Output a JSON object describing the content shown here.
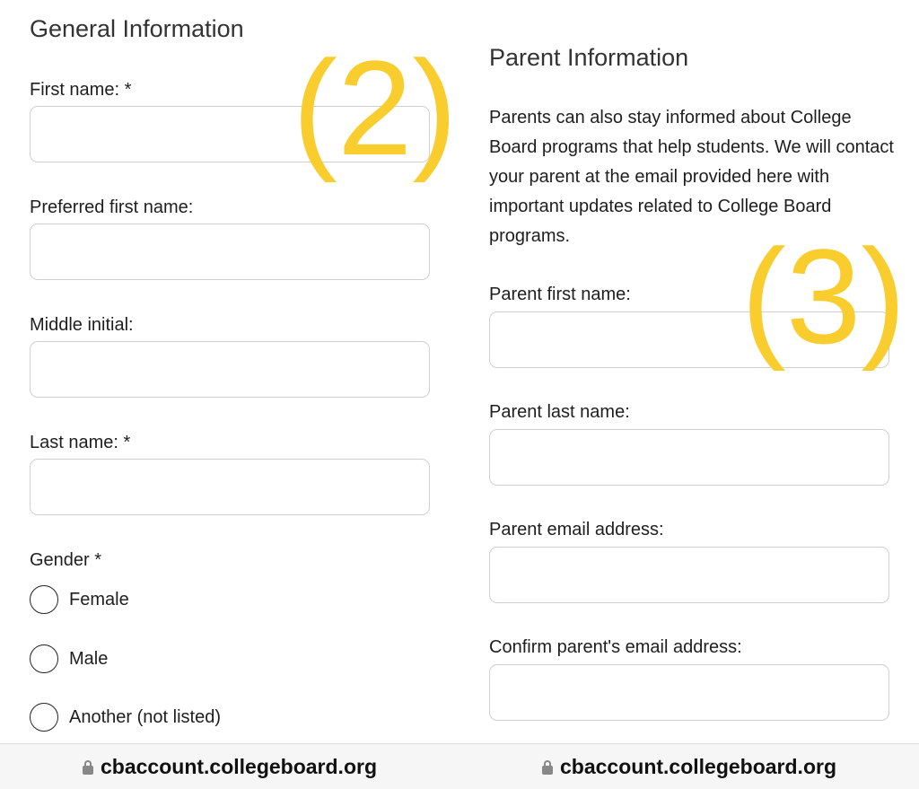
{
  "left": {
    "title": "General Information",
    "fields": [
      {
        "label": "First name: *",
        "value": ""
      },
      {
        "label": "Preferred first name:",
        "value": ""
      },
      {
        "label": "Middle initial:",
        "value": ""
      },
      {
        "label": "Last name: *",
        "value": ""
      }
    ],
    "gender": {
      "label": "Gender *",
      "options": [
        {
          "label": "Female",
          "selected": false
        },
        {
          "label": "Male",
          "selected": false
        },
        {
          "label": "Another (not listed)",
          "selected": false
        }
      ]
    },
    "annotation": "(2)",
    "url": "cbaccount.collegeboard.org"
  },
  "right": {
    "title": "Parent Information",
    "description": "Parents can also stay informed about College Board programs that help students. We will contact your parent at the email provided here with important updates related to College Board programs.",
    "fields": [
      {
        "label": "Parent first name:",
        "value": ""
      },
      {
        "label": "Parent last name:",
        "value": ""
      },
      {
        "label": "Parent email address:",
        "value": ""
      },
      {
        "label": "Confirm parent's email address:",
        "value": ""
      }
    ],
    "annotation": "(3)",
    "url": "cbaccount.collegeboard.org"
  },
  "colors": {
    "annotation": "#f9cd2e",
    "border": "#cfcfcf",
    "footer_bg": "#f6f6f6"
  },
  "icons": {
    "footer": "lock-icon"
  }
}
